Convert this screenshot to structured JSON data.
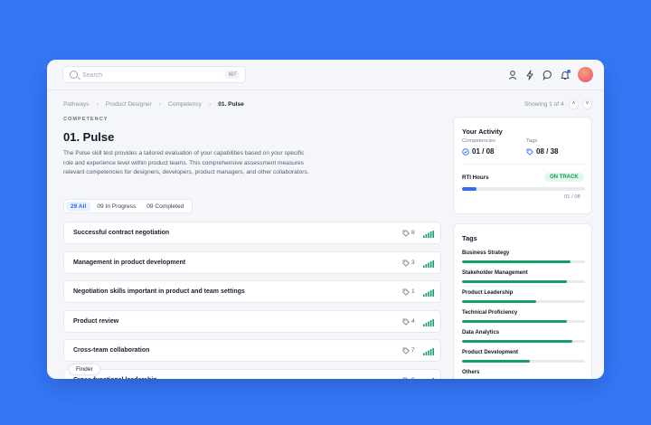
{
  "search": {
    "placeholder": "Search",
    "shortcut": "⌘F"
  },
  "header_icons": [
    "user-icon",
    "bolt-icon",
    "chat-icon",
    "bell-icon"
  ],
  "breadcrumb": [
    "Pathways",
    "Product Designer",
    "Competency",
    "01. Pulse"
  ],
  "pager": {
    "text": "Showing 1 of 4"
  },
  "page": {
    "eyebrow": "COMPETENCY",
    "title": "01. Pulse",
    "description": "The Pulse skill test provides a tailored evaluation of your capabilities based on your specific role and experience level within product teams. This comprehensive assessment measures relevant competencies for designers, developers, product managers, and other collaborators."
  },
  "filters": [
    {
      "label": "29 All",
      "active": true
    },
    {
      "label": "09 In Progress",
      "active": false
    },
    {
      "label": "09 Completed",
      "active": false
    }
  ],
  "competencies": [
    {
      "name": "Successful contract negotiation",
      "tags": "8"
    },
    {
      "name": "Management in product development",
      "tags": "3"
    },
    {
      "name": "Negotiation skills important in product and team settings",
      "tags": "1"
    },
    {
      "name": "Product review",
      "tags": "4"
    },
    {
      "name": "Cross-team collaboration",
      "tags": "7"
    },
    {
      "name": "Cross-functional leadership",
      "tags": "9"
    }
  ],
  "finder": {
    "label": "Finder"
  },
  "activity": {
    "title": "Your Activity",
    "competencies_label": "Competencies",
    "competencies_value": "01 / 08",
    "tags_label": "Tags",
    "tags_value": "08 / 38",
    "rti_label": "RTI Hours",
    "rti_status": "ON TRACK",
    "rti_progress": 0.12,
    "rti_count": "01 / 08"
  },
  "tags_card": {
    "title": "Tags",
    "items": [
      {
        "name": "Business Strategy",
        "level": 0.88
      },
      {
        "name": "Stakeholder Management",
        "level": 0.85
      },
      {
        "name": "Product Leadership",
        "level": 0.6
      },
      {
        "name": "Technical Proficiency",
        "level": 0.85
      },
      {
        "name": "Data Analytics",
        "level": 0.9
      },
      {
        "name": "Product Development",
        "level": 0.55
      },
      {
        "name": "Others",
        "level": 0.25
      }
    ]
  },
  "colors": {
    "accent": "#2f6ef2",
    "success": "#15a06a",
    "background": "#3577f6"
  }
}
